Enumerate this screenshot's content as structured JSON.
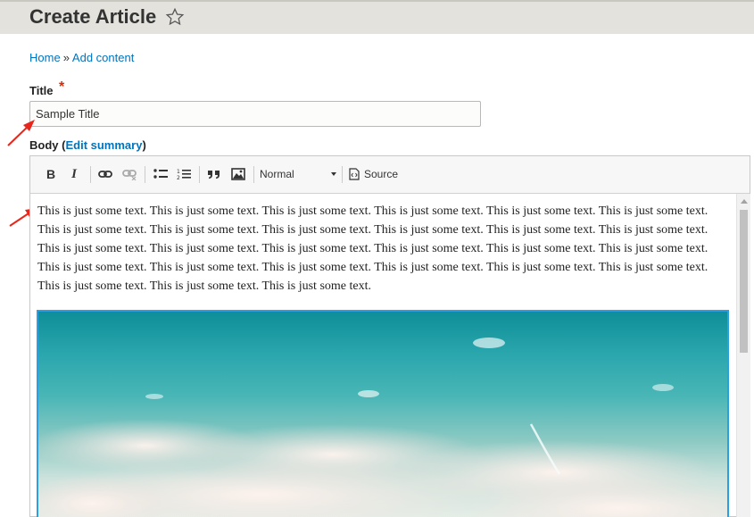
{
  "header": {
    "title": "Create Article",
    "favorite_icon": "star-outline-icon"
  },
  "breadcrumb": {
    "home": "Home",
    "separator": "»",
    "current": "Add content"
  },
  "title_field": {
    "label": "Title",
    "required_marker": "*",
    "value": "Sample Title"
  },
  "body_field": {
    "label": "Body",
    "open_paren": "(",
    "edit_summary": "Edit summary",
    "close_paren": ")"
  },
  "toolbar": {
    "bold": "B",
    "italic": "I",
    "format_value": "Normal",
    "source_label": "Source",
    "icons": [
      "bold-icon",
      "italic-icon",
      "link-icon",
      "unlink-icon",
      "bulleted-list-icon",
      "numbered-list-icon",
      "blockquote-icon",
      "image-icon",
      "source-icon"
    ]
  },
  "editor": {
    "text": "This is just some text. This is just some text. This is just some text. This is just some text. This is just some text. This is just some text. This is just some text. This is just some text. This is just some text. This is just some text. This is just some text. This is just some text. This is just some text. This is just some text. This is just some text. This is just some text. This is just some text. This is just some text. This is just some text. This is just some text. This is just some text. This is just some text. This is just some text. This is just some text. This is just some text. This is just some text. This is just some text."
  },
  "colors": {
    "link": "#0074bd",
    "required": "#e62600",
    "arrow": "#e8261c",
    "image_border": "#2aa0e0"
  }
}
